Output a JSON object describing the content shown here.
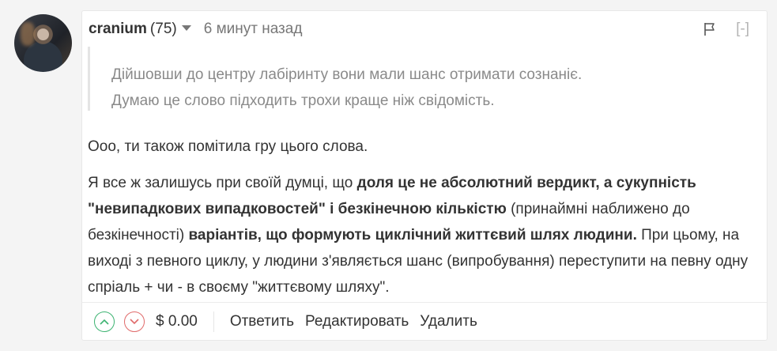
{
  "comment": {
    "author": "cranium",
    "reputation": "(75)",
    "time": "6 минут назад",
    "collapse_label": "[-]",
    "quote": [
      "Дійшовши до центру лабіринту вони мали шанс отримати сознаніє.",
      "Думаю це слово підходить трохи краще ніж свідомість."
    ],
    "paragraph1": "Ооо, ти також помітила гру цього слова.",
    "paragraph2": {
      "t1": "Я все ж залишусь при своїй думці, що ",
      "b1": "доля це не абсолютний вердикт, а сукупність \"невипадкових випадковостей\" і безкінечною кількістю",
      "t2": " (принаймні наближено до безкінечності) ",
      "b2": "варіантів, що формують циклічний життєвий шлях людини.",
      "t3": " При цьому, на виході з певного циклу, у людини з'являється шанс (випробування) переступити на певну одну спріаль + чи - в своєму \"життєвому шляху\"."
    }
  },
  "footer": {
    "payout": "$ 0.00",
    "reply_label": "Ответить",
    "edit_label": "Редактировать",
    "delete_label": "Удалить"
  },
  "colors": {
    "upvote": "#3cb371",
    "downvote": "#e06a6a"
  },
  "icons": [
    "flag-icon",
    "chevron-up-icon",
    "chevron-down-icon",
    "caret-down-icon"
  ]
}
